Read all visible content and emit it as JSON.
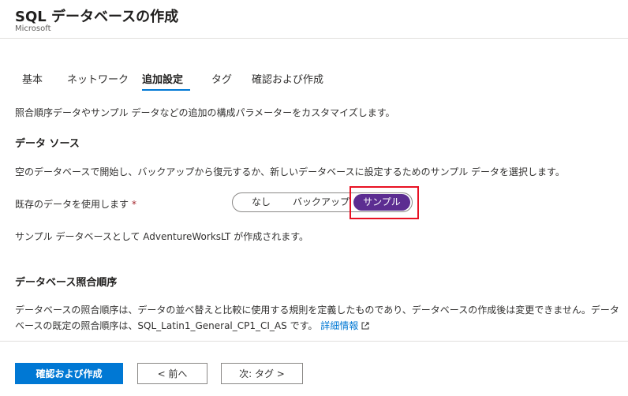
{
  "header": {
    "title": "SQL データベースの作成",
    "publisher": "Microsoft"
  },
  "tabs": [
    {
      "label": "基本"
    },
    {
      "label": "ネットワーク"
    },
    {
      "label": "追加設定",
      "active": true
    },
    {
      "label": "タグ"
    },
    {
      "label": "確認および作成"
    }
  ],
  "intro": "照合順序データやサンプル データなどの追加の構成パラメーターをカスタマイズします。",
  "data_source": {
    "heading": "データ ソース",
    "description": "空のデータベースで開始し、バックアップから復元するか、新しいデータベースに設定するためのサンプル データを選択します。",
    "field_label": "既存のデータを使用します",
    "required_mark": "*",
    "options": [
      "なし",
      "バックアップ",
      "サンプル"
    ],
    "selected": "サンプル",
    "note": "サンプル データベースとして AdventureWorksLT が作成されます。"
  },
  "collation": {
    "heading": "データベース照合順序",
    "line1": "データベースの照合順序は、データの並べ替えと比較に使用する規則を定義したものであり、データベースの作成後は変更できません。データ",
    "line2": "ベースの既定の照合順序は、SQL_Latin1_General_CP1_CI_AS です。",
    "link": "詳細情報"
  },
  "footer": {
    "review_create": "確認および作成",
    "previous": "< 前へ",
    "next": "次: タグ >"
  },
  "colors": {
    "accent": "#0078d4",
    "selected_option": "#5c2d91",
    "highlight": "#e81123"
  }
}
